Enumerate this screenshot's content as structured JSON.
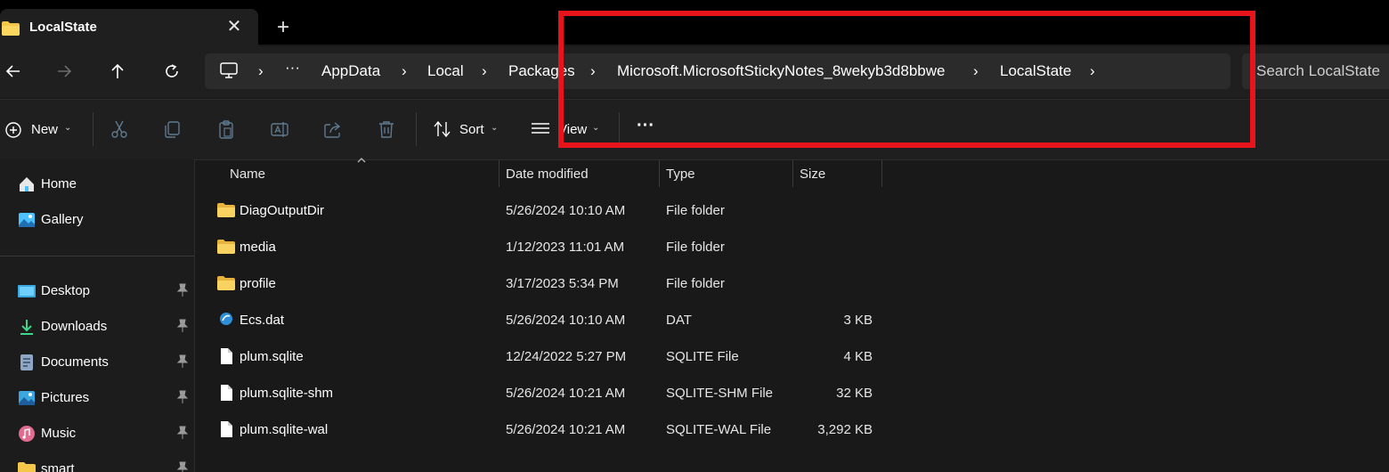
{
  "window": {
    "tab_title": "LocalState",
    "close_glyph": "✕",
    "new_tab_glyph": "+"
  },
  "navigation": {
    "back_icon": "arrow-left-icon",
    "forward_icon": "arrow-right-icon",
    "up_icon": "arrow-up-icon",
    "refresh_icon": "refresh-icon"
  },
  "address": {
    "overflow_glyph": "···",
    "breadcrumbs": [
      "AppData",
      "Local",
      "Packages",
      "Microsoft.MicrosoftStickyNotes_8wekyb3d8bbwe",
      "LocalState"
    ],
    "chevron_glyph": "›",
    "search_placeholder": "Search LocalState"
  },
  "toolbar": {
    "new_label": "New",
    "sort_label": "Sort",
    "view_label": "View",
    "more_glyph": "···",
    "dropdown_glyph": "⌄",
    "icons": [
      "cut-icon",
      "copy-icon",
      "paste-icon",
      "rename-icon",
      "share-icon",
      "delete-icon"
    ]
  },
  "sidebar": {
    "items": [
      {
        "label": "Home",
        "icon": "home-icon",
        "pinned": false
      },
      {
        "label": "Gallery",
        "icon": "gallery-icon",
        "pinned": false
      },
      {
        "label": "Desktop",
        "icon": "desktop-icon",
        "pinned": true
      },
      {
        "label": "Downloads",
        "icon": "download-icon",
        "pinned": true
      },
      {
        "label": "Documents",
        "icon": "documents-icon",
        "pinned": true
      },
      {
        "label": "Pictures",
        "icon": "pictures-icon",
        "pinned": true
      },
      {
        "label": "Music",
        "icon": "music-icon",
        "pinned": true
      },
      {
        "label": "smart",
        "icon": "folder-icon",
        "pinned": true
      }
    ]
  },
  "file_list": {
    "columns": [
      "Name",
      "Date modified",
      "Type",
      "Size"
    ],
    "rows": [
      {
        "name": "DiagOutputDir",
        "date": "5/26/2024 10:10 AM",
        "type": "File folder",
        "size": "",
        "icon": "folder-icon"
      },
      {
        "name": "media",
        "date": "1/12/2023 11:01 AM",
        "type": "File folder",
        "size": "",
        "icon": "folder-icon"
      },
      {
        "name": "profile",
        "date": "3/17/2023 5:34 PM",
        "type": "File folder",
        "size": "",
        "icon": "folder-icon"
      },
      {
        "name": "Ecs.dat",
        "date": "5/26/2024 10:10 AM",
        "type": "DAT",
        "size": "3 KB",
        "icon": "dat-file-icon"
      },
      {
        "name": "plum.sqlite",
        "date": "12/24/2022 5:27 PM",
        "type": "SQLITE File",
        "size": "4 KB",
        "icon": "file-icon"
      },
      {
        "name": "plum.sqlite-shm",
        "date": "5/26/2024 10:21 AM",
        "type": "SQLITE-SHM File",
        "size": "32 KB",
        "icon": "file-icon"
      },
      {
        "name": "plum.sqlite-wal",
        "date": "5/26/2024 10:21 AM",
        "type": "SQLITE-WAL File",
        "size": "3,292 KB",
        "icon": "file-icon"
      }
    ]
  },
  "colors": {
    "background": "#191919",
    "highlight": "#e8141c",
    "folder": "#f4c74a",
    "accent": "#4cc2ff"
  }
}
